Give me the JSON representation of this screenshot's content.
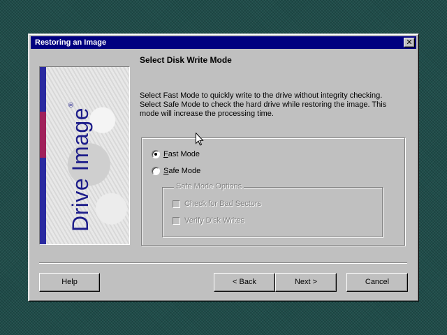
{
  "window": {
    "title": "Restoring an Image",
    "close_glyph": "✕"
  },
  "page": {
    "heading": "Select Disk Write Mode",
    "description": "Select Fast Mode to quickly write to the drive without integrity checking.  Select Safe Mode to check the hard drive while restoring the image.  This mode will increase the processing time."
  },
  "side_image": {
    "product_name": "Drive Image",
    "trademark": "®",
    "colors": {
      "blue": "#2a2aa0",
      "magenta": "#a0205a",
      "text": "#1c1c8a"
    }
  },
  "modes": {
    "selected": "fast",
    "fast": {
      "label": "Fast Mode",
      "mnemonic": "F",
      "checked": true
    },
    "safe": {
      "label": "Safe Mode",
      "mnemonic": "S",
      "checked": false
    }
  },
  "safe_options": {
    "legend": "Safe Mode Options",
    "enabled": false,
    "check_bad_sectors": {
      "label": "Check for Bad Sectors",
      "checked": false
    },
    "verify_disk_writes": {
      "label": "Verify Disk Writes",
      "checked": false
    }
  },
  "buttons": {
    "help": "Help",
    "back_prefix": "< ",
    "back": "Back",
    "next": "Next",
    "next_suffix": " >",
    "cancel": "Cancel"
  },
  "icons": {
    "close": "close-icon",
    "cursor": "mouse-pointer-icon"
  }
}
